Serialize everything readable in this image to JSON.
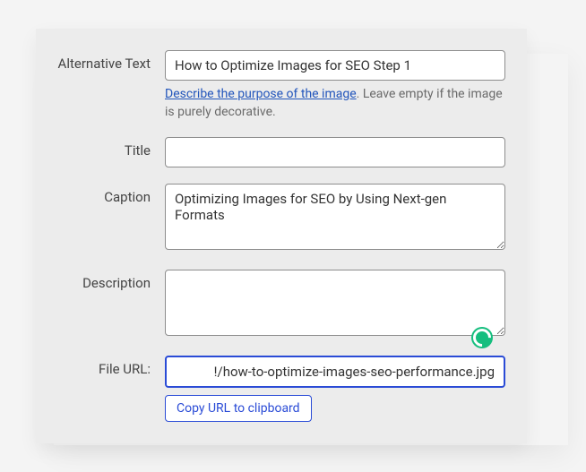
{
  "labels": {
    "altText": "Alternative Text",
    "title": "Title",
    "caption": "Caption",
    "description": "Description",
    "fileUrl": "File URL:"
  },
  "values": {
    "altText": "How to Optimize Images for SEO Step 1",
    "title": "",
    "caption": "Optimizing Images for SEO by Using Next-gen Formats",
    "description": "",
    "fileUrl": "!/how-to-optimize-images-seo-performance.jpg"
  },
  "hint": {
    "link": "Describe the purpose of the image",
    "rest": ". Leave empty if the image is purely decorative."
  },
  "buttons": {
    "copy": "Copy URL to clipboard"
  }
}
